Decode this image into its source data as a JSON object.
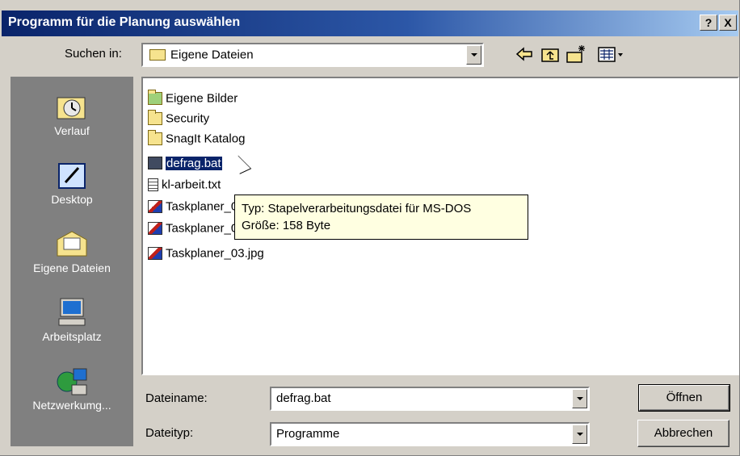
{
  "window": {
    "title": "Programm für die Planung auswählen",
    "help_label": "?",
    "close_label": "X"
  },
  "look_in": {
    "label": "Suchen in:",
    "value": "Eigene Dateien"
  },
  "places": [
    {
      "label": "Verlauf",
      "icon": "history-icon"
    },
    {
      "label": "Desktop",
      "icon": "desktop-icon"
    },
    {
      "label": "Eigene Dateien",
      "icon": "my-documents-icon"
    },
    {
      "label": "Arbeitsplatz",
      "icon": "my-computer-icon"
    },
    {
      "label": "Netzwerkumg...",
      "icon": "network-icon"
    }
  ],
  "files": [
    {
      "name": "Eigene Bilder",
      "icon": "pictures-folder-icon"
    },
    {
      "name": "Security",
      "icon": "folder-icon"
    },
    {
      "name": "SnagIt Katalog",
      "icon": "folder-icon"
    },
    {
      "name": "defrag.bat",
      "icon": "batch-file-icon",
      "selected": true
    },
    {
      "name": "kl-arbeit.txt",
      "icon": "text-file-icon"
    },
    {
      "name": "Taskplaner_01.jpg",
      "icon": "image-file-icon"
    },
    {
      "name": "Taskplaner_02.jpg",
      "icon": "image-file-icon"
    },
    {
      "name": "Taskplaner_03.jpg",
      "icon": "image-file-icon"
    }
  ],
  "tooltip": {
    "line1": "Typ: Stapelverarbeitungsdatei für MS-DOS",
    "line2": "Größe: 158 Byte"
  },
  "filename": {
    "label": "Dateiname:",
    "value": "defrag.bat"
  },
  "filetype": {
    "label": "Dateityp:",
    "value": "Programme"
  },
  "buttons": {
    "open": "Öffnen",
    "cancel": "Abbrechen"
  }
}
